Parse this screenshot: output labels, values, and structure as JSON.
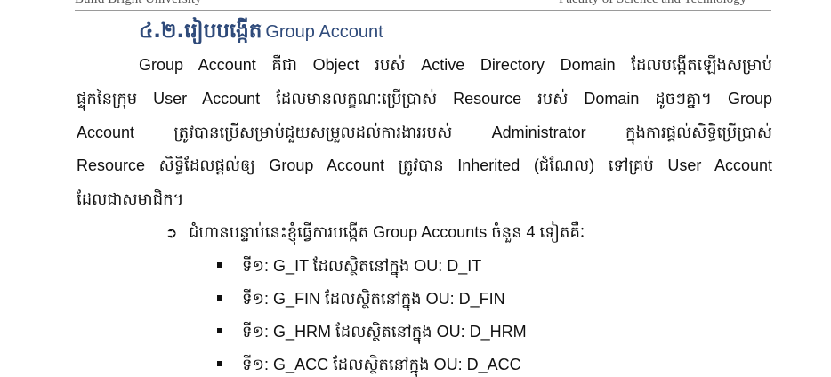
{
  "header": {
    "left_text": "Build Bright University",
    "right_text": "Faculty of Science and Technology"
  },
  "heading": {
    "number": "៤.២.រៀបបង្កើត",
    "text": "Group Account"
  },
  "paragraph": {
    "lines": [
      "Group Account គឺជា Object របស់ Active Directory Domain ដែលបង្កើតឡើងសម្រាប់",
      "ផ្ទុកនៃក្រុម User Account ដែលមានលក្ខណៈប្រើប្រាស់ Resource របស់ Domain ដូចៗគ្នា។ Group",
      "Account ត្រូវបានប្រើសម្រាប់ជួយសម្រួលដល់ការងាររបស់ Administrator ក្នុងការផ្តល់សិទ្ធិប្រើប្រាស់",
      "Resource សិទ្ធិដែលផ្តល់ឲ្យ Group Account ត្រូវបាន Inherited (ជំណែល) ទៅគ្រប់ User Account",
      "ដែលជាសមាជិក។"
    ]
  },
  "intro": {
    "marker": "➲",
    "text": "ជំហានបន្ទាប់នេះខ្ញុំធ្វើការបង្កើត Group Accounts  ចំនួន 4 ទៀតគឺៈ"
  },
  "items": [
    "ទី១: G_IT ដែលស្ថិតនៅក្នុង OU: D_IT",
    "ទី១: G_FIN ដែលស្ថិតនៅក្នុង OU: D_FIN",
    "ទី១: G_HRM ដែលស្ថិតនៅក្នុង OU: D_HRM",
    "ទី១: G_ACC ដែលស្ថិតនៅក្នុង OU: D_ACC"
  ]
}
